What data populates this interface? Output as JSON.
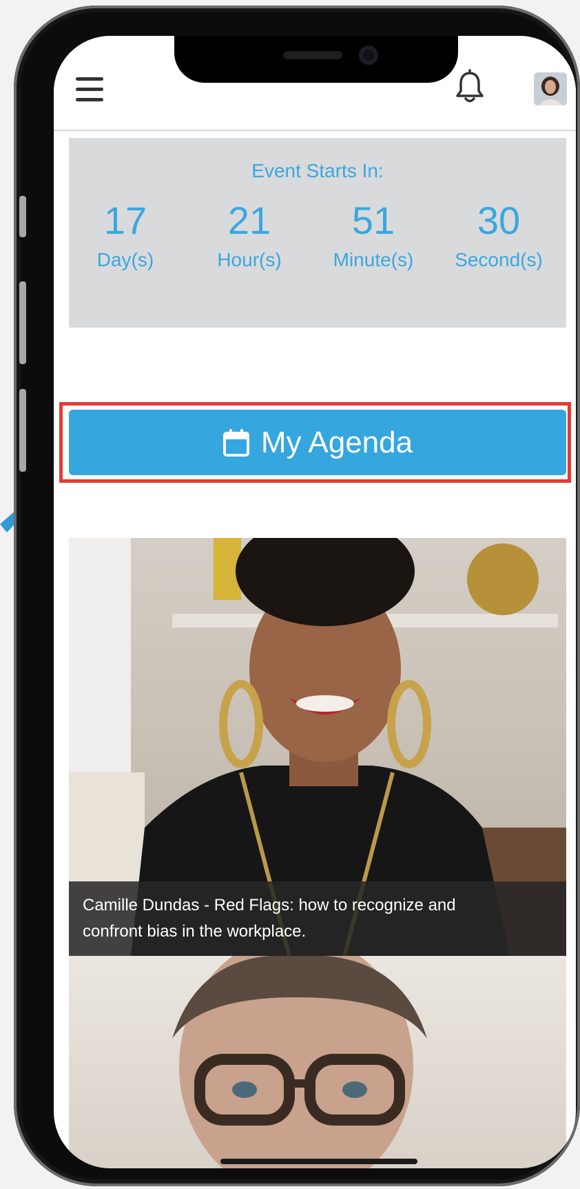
{
  "colors": {
    "accent": "#35a6de",
    "countdown_text": "#3aa7de",
    "highlight_outline": "#e23b34",
    "caption_bg": "#262626"
  },
  "header": {
    "menu_icon": "hamburger-menu-icon",
    "notification_icon": "bell-icon",
    "avatar": "user-avatar"
  },
  "countdown": {
    "title": "Event Starts In:",
    "units": [
      {
        "value": "17",
        "label": "Day(s)"
      },
      {
        "value": "21",
        "label": "Hour(s)"
      },
      {
        "value": "51",
        "label": "Minute(s)"
      },
      {
        "value": "30",
        "label": "Second(s)"
      }
    ]
  },
  "agenda_button": {
    "icon": "calendar-icon",
    "label": "My Agenda"
  },
  "sessions": [
    {
      "caption_line1": "Camille Dundas - Red Flags: how to recognize and",
      "caption_line2": "confront bias in the workplace."
    },
    {
      "caption_line1": "",
      "caption_line2": ""
    }
  ]
}
